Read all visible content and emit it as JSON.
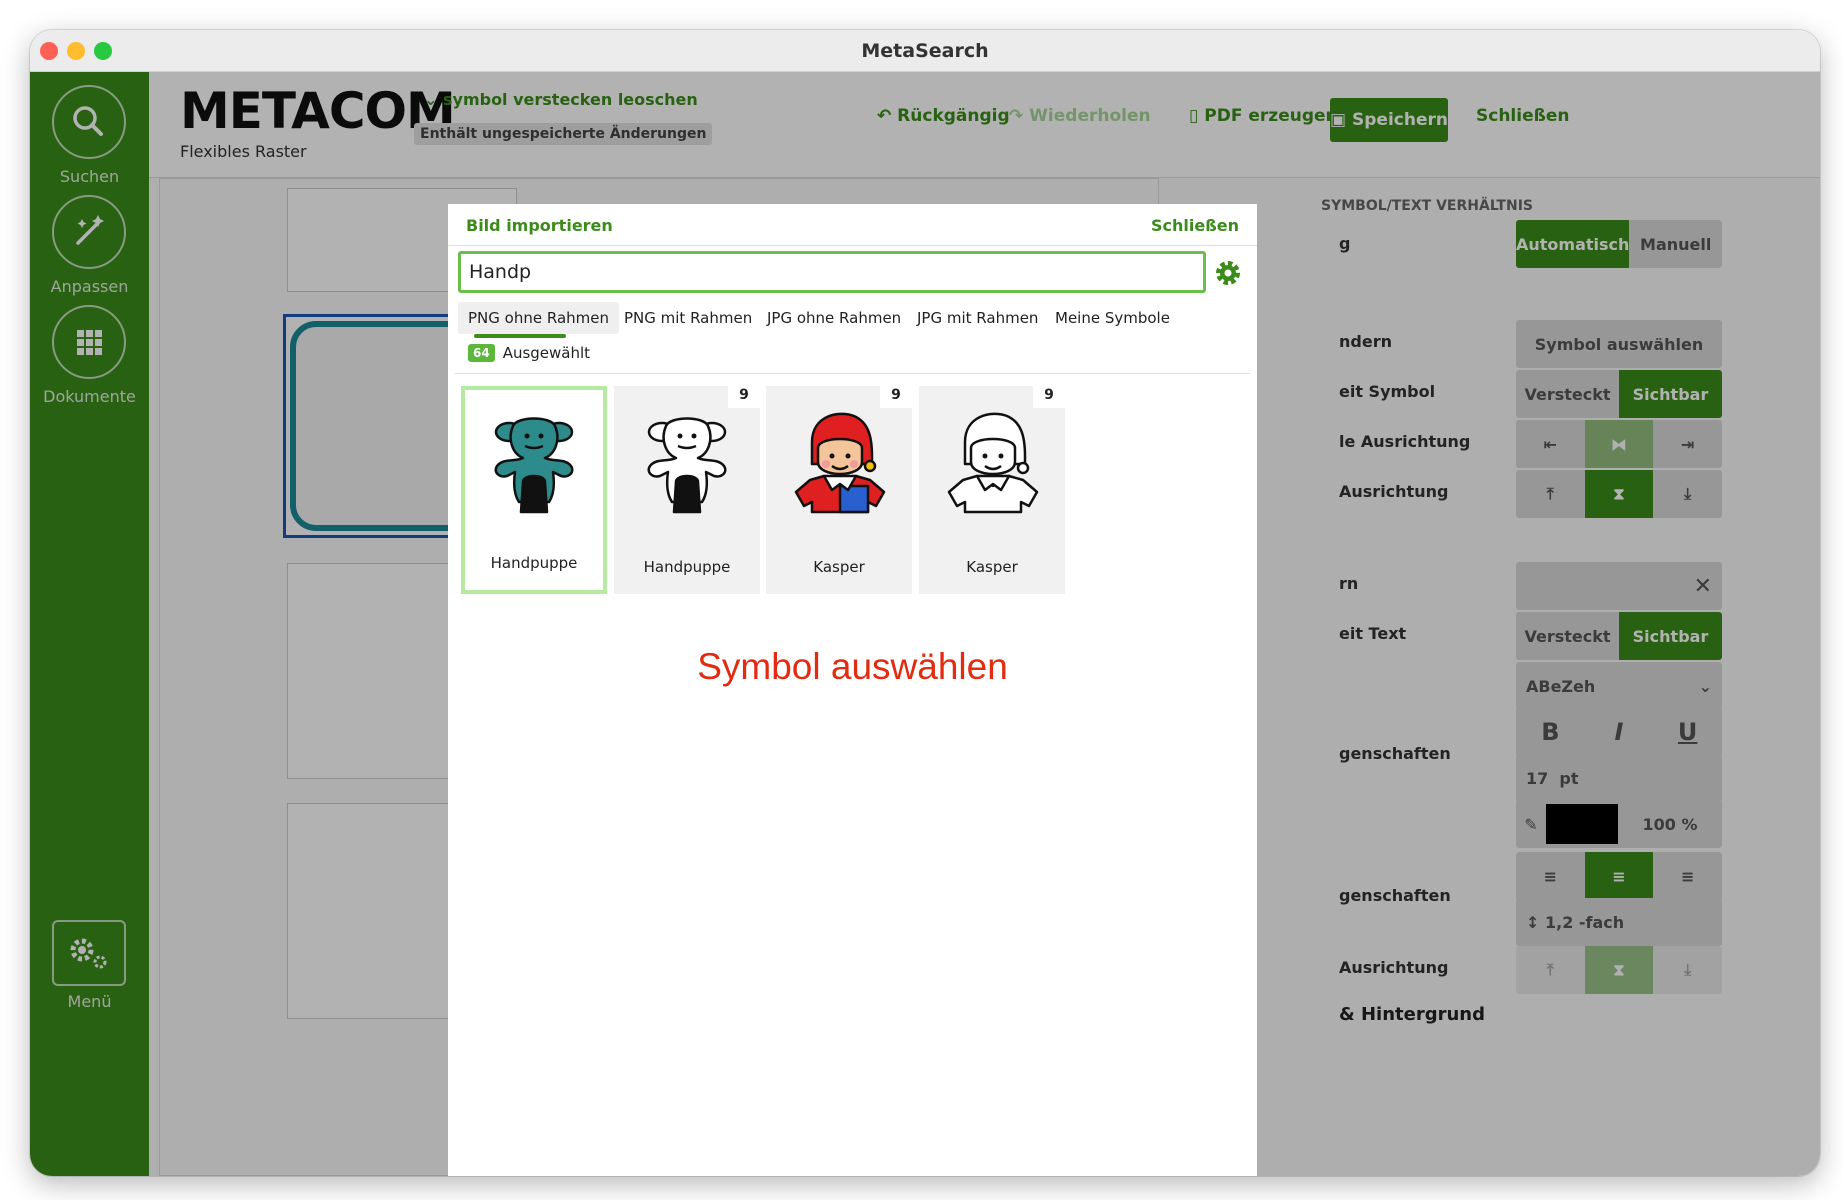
{
  "window": {
    "title": "MetaSearch"
  },
  "sidebar": {
    "items": [
      {
        "label": "Suchen",
        "icon": "search-icon"
      },
      {
        "label": "Anpassen",
        "icon": "magic-wand-icon"
      },
      {
        "label": "Dokumente",
        "icon": "grid-icon"
      }
    ],
    "menu_label": "Menü",
    "menu_icon": "gears-icon"
  },
  "header": {
    "logo": "METACOM",
    "subtitle": "Flexibles Raster",
    "doc_name": "symbol verstecken leoschen",
    "unsaved": "Enthält ungespeicherte Änderungen",
    "undo": "Rückgängig",
    "redo": "Wiederholen",
    "pdf": "PDF erzeugen",
    "save": "Speichern",
    "close": "Schließen"
  },
  "right_panel": {
    "section_title": "SYMBOL/TEXT VERHÄLTNIS",
    "ratio_label": "g",
    "auto": "Automatisch",
    "manual": "Manuell",
    "change_label": "ndern",
    "choose_symbol": "Symbol auswählen",
    "symbol_vis_label": "eit Symbol",
    "hidden": "Versteckt",
    "visible": "Sichtbar",
    "halign_label": "le Ausrichtung",
    "valign_label": "Ausrichtung",
    "text_label": "rn",
    "text_vis_label": "eit Text",
    "font": "ABeZeh",
    "props_label": "genschaften",
    "font_size": "17",
    "font_unit": "pt",
    "opacity": "100",
    "opacity_unit": "%",
    "para_label": "genschaften",
    "line_spacing": "1,2",
    "line_unit": "-fach",
    "valign2_label": "Ausrichtung",
    "bg_label": "& Hintergrund",
    "bold": "B",
    "italic": "I",
    "underline": "U"
  },
  "modal": {
    "title": "Bild importieren",
    "close": "Schließen",
    "search_value": "Handp",
    "tabs": [
      "PNG ohne Rahmen",
      "PNG mit Rahmen",
      "JPG ohne Rahmen",
      "JPG mit Rahmen",
      "Meine Symbole"
    ],
    "active_tab": "PNG ohne Rahmen",
    "selected_count": "64",
    "selected_label": "Ausgewählt",
    "results": [
      {
        "name": "Handpuppe",
        "count": "",
        "selected": true
      },
      {
        "name": "Handpuppe",
        "count": "9",
        "selected": false
      },
      {
        "name": "Kasper",
        "count": "9",
        "selected": false
      },
      {
        "name": "Kasper",
        "count": "9",
        "selected": false
      }
    ],
    "annotation": "Symbol auswählen"
  },
  "colors": {
    "accent": "#3c8c1b",
    "highlight": "#6bc04a",
    "annotation": "#e32b12"
  }
}
